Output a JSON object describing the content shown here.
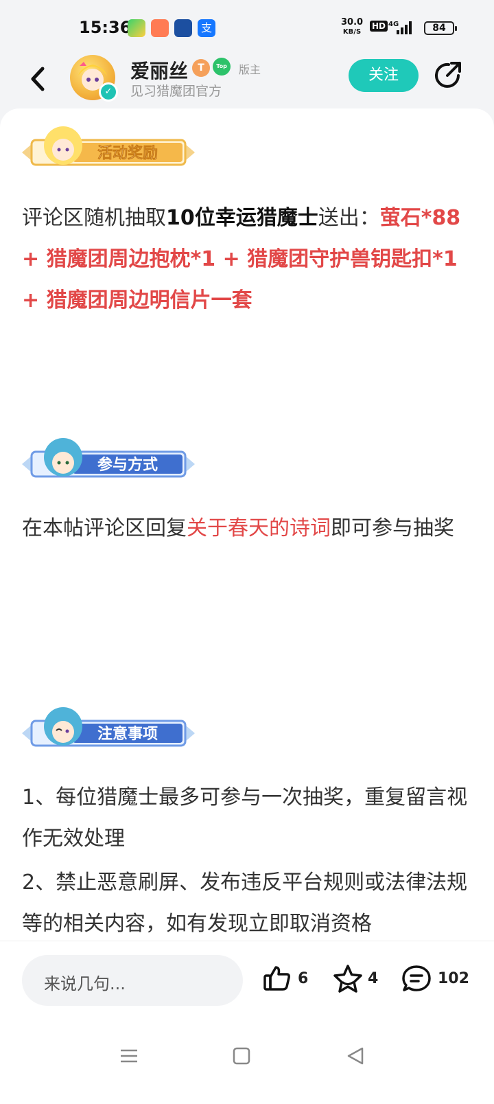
{
  "status": {
    "time": "15:36",
    "net_speed": "30.0",
    "net_unit": "KB/S",
    "hd": "HD",
    "net_type": "4G",
    "battery": "84"
  },
  "header": {
    "author_name": "爱丽丝",
    "badge_t": "T",
    "badge_top": "Top",
    "role": "版主",
    "subtitle": "见习猎魔团官方",
    "follow_label": "关注"
  },
  "sections": {
    "reward": {
      "banner": "活动奖励",
      "intro": "评论区随机抽取",
      "bold": "10位幸运猎魔士",
      "mid": "送出：",
      "prizes": "萤石*88 + 猎魔团周边抱枕*1 + 猎魔团守护兽钥匙扣*1 + 猎魔团周边明信片一套"
    },
    "how": {
      "banner": "参与方式",
      "pre": "在本帖评论区回复",
      "highlight": "关于春天的诗词",
      "post": "即可参与抽奖"
    },
    "notes": {
      "banner": "注意事项",
      "item1": "1、每位猎魔士最多可参与一次抽奖，重复留言视作无效处理",
      "item2": "2、禁止恶意刷屏、发布违反平台规则或法律法规等的相关内容，如有发现立即取消资格"
    }
  },
  "bottom_bar": {
    "comment_placeholder": "来说几句...",
    "likes": "6",
    "favorites": "4",
    "comments": "102"
  },
  "colors": {
    "accent": "#1fc9b9",
    "highlight": "#e24848"
  }
}
